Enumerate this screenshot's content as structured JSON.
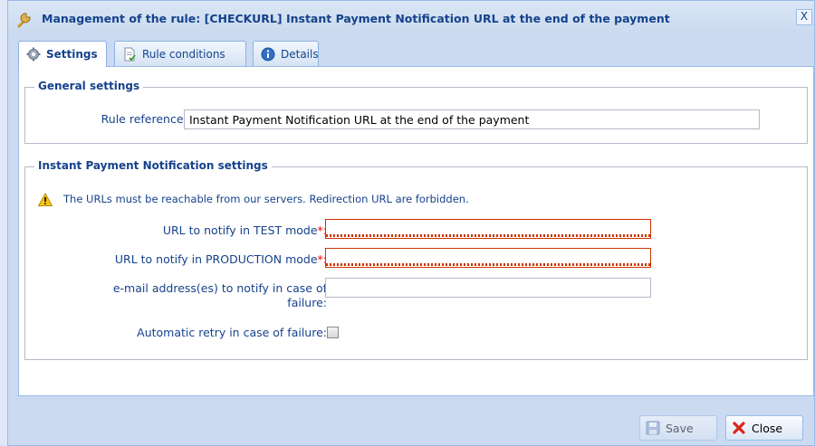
{
  "window": {
    "title": "Management of the rule: [CHECKURL] Instant Payment Notification URL at the end of the payment",
    "close_label": "X"
  },
  "tabs": [
    {
      "label": "Settings",
      "icon": "gear-icon",
      "active": true
    },
    {
      "label": "Rule conditions",
      "icon": "document-icon",
      "active": false
    },
    {
      "label": "Details",
      "icon": "info-icon",
      "active": false
    }
  ],
  "general": {
    "legend": "General settings",
    "rule_reference_label": "Rule reference",
    "required_mark": "*:",
    "rule_reference_value": "Instant Payment Notification URL at the end of the payment"
  },
  "ipn": {
    "legend": "Instant Payment Notification settings",
    "warning": "The URLs must be reachable from our servers. Redirection URL are forbidden.",
    "url_test_label": "URL to notify in TEST mode",
    "url_test_value": "",
    "url_prod_label": "URL to notify in PRODUCTION mode",
    "url_prod_value": "",
    "email_label_line1": "e-mail address(es) to notify in case of",
    "email_label_line2": "failure:",
    "email_value": "",
    "retry_label": "Automatic retry in case of failure:",
    "retry_checked": false
  },
  "buttons": {
    "save_label": "Save",
    "close_label": "Close"
  },
  "colors": {
    "accent": "#15428b",
    "required": "#ff0000",
    "invalid_border": "#cc3300"
  }
}
